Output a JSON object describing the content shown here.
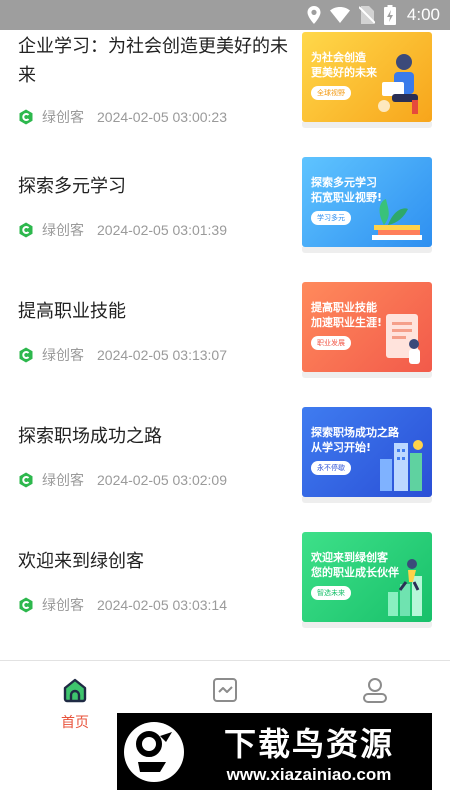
{
  "status_bar": {
    "time": "4:00",
    "icons": [
      "location-icon",
      "wifi-icon",
      "no-sim-icon",
      "battery-charging-icon"
    ]
  },
  "articles": [
    {
      "title": "企业学习：为社会创造更美好的未来",
      "source": "绿创客",
      "date": "2024-02-05 03:00:23",
      "thumb": {
        "lines": [
          "为社会创造",
          "更美好的未来"
        ],
        "tag": "全球视野",
        "colors": [
          "#ffd84a",
          "#f7a51b"
        ],
        "tag_color": "#f39a12",
        "art": "reading-person-art"
      }
    },
    {
      "title": "探索多元学习",
      "source": "绿创客",
      "date": "2024-02-05 03:01:39",
      "thumb": {
        "lines": [
          "探索多元学习",
          "拓宽职业视野!"
        ],
        "tag": "学习多元",
        "colors": [
          "#5fc4ff",
          "#2e8ff0"
        ],
        "tag_color": "#2e8ff0",
        "art": "books-plant-art"
      }
    },
    {
      "title": "提高职业技能",
      "source": "绿创客",
      "date": "2024-02-05 03:13:07",
      "thumb": {
        "lines": [
          "提高职业技能",
          "加速职业生涯!"
        ],
        "tag": "职业发展",
        "colors": [
          "#ff8a5c",
          "#f25a4a"
        ],
        "tag_color": "#f25a4a",
        "art": "document-person-art"
      }
    },
    {
      "title": "探索职场成功之路",
      "source": "绿创客",
      "date": "2024-02-05 03:02:09",
      "thumb": {
        "lines": [
          "探索职场成功之路",
          "从学习开始!"
        ],
        "tag": "永不停歇",
        "colors": [
          "#3f7cf0",
          "#2a4fd6"
        ],
        "tag_color": "#2a4fd6",
        "art": "buildings-art"
      }
    },
    {
      "title": "欢迎来到绿创客",
      "source": "绿创客",
      "date": "2024-02-05 03:03:14",
      "thumb": {
        "lines": [
          "欢迎来到绿创客",
          "您的职业成长伙伴"
        ],
        "tag": "智选未来",
        "colors": [
          "#3ee089",
          "#18c06a"
        ],
        "tag_color": "#18c06a",
        "art": "climbing-person-art"
      }
    }
  ],
  "bottom_nav": {
    "items": [
      {
        "label": "首页",
        "icon": "home-icon",
        "active": true
      },
      {
        "label": "",
        "icon": "chart-icon",
        "active": false
      },
      {
        "label": "",
        "icon": "profile-icon",
        "active": false
      }
    ]
  },
  "watermark": {
    "title": "下载鸟资源",
    "url": "www.xiazainiao.com",
    "logo": "bird-logo"
  },
  "colors": {
    "accent": "#e8533b",
    "source_green": "#2db84d",
    "text": "#222222",
    "meta": "#9a9a9a"
  }
}
